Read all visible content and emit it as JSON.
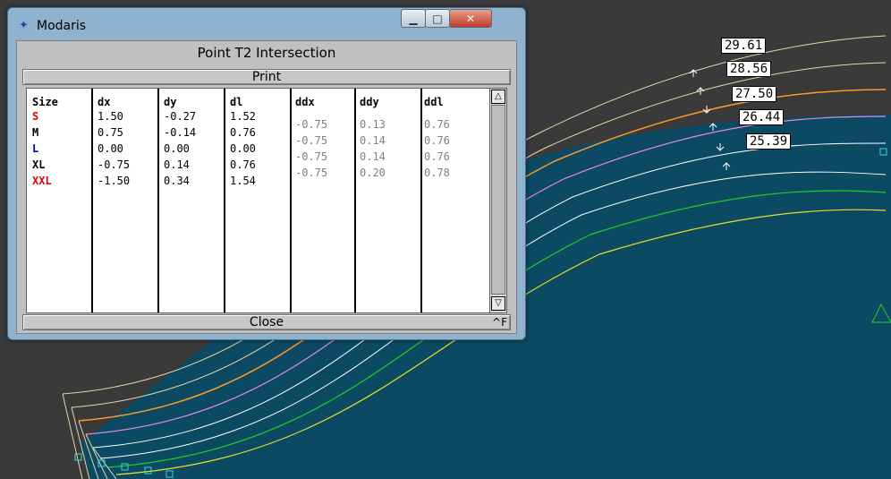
{
  "window": {
    "app_title": "Modaris",
    "controls": {
      "minimize": "▁",
      "maximize": "□",
      "close": "✕"
    }
  },
  "dialog": {
    "title": "Point T2 Intersection",
    "print_label": "Print",
    "close_label": "Close",
    "shortcut": "^F",
    "columns": [
      "Size",
      "dx",
      "dy",
      "dl",
      "ddx",
      "ddy",
      "ddl"
    ],
    "rows": [
      {
        "size": "S",
        "dx": "1.50",
        "dy": "-0.27",
        "dl": "1.52",
        "ddx": "-0.75",
        "ddy": "0.13",
        "ddl": "0.76",
        "color": "#e00000"
      },
      {
        "size": "M",
        "dx": "0.75",
        "dy": "-0.14",
        "dl": "0.76",
        "ddx": "-0.75",
        "ddy": "0.14",
        "ddl": "0.76",
        "color": "#000000"
      },
      {
        "size": "L",
        "dx": "0.00",
        "dy": "0.00",
        "dl": "0.00",
        "ddx": "-0.75",
        "ddy": "0.14",
        "ddl": "0.76",
        "color": "#0000cc"
      },
      {
        "size": "XL",
        "dx": "-0.75",
        "dy": "0.14",
        "dl": "0.76",
        "ddx": "-0.75",
        "ddy": "0.20",
        "ddl": "0.78",
        "color": "#000000"
      },
      {
        "size": "XXL",
        "dx": "-1.50",
        "dy": "0.34",
        "dl": "1.54",
        "color": "#e00000"
      }
    ]
  },
  "canvas": {
    "labels": [
      "29.61",
      "28.56",
      "27.50",
      "26.44",
      "25.39"
    ],
    "fill_color": "#0c4a63",
    "curve_colors": [
      "#e8d6a8",
      "#f0f0f0",
      "#ff9a2a",
      "#e08ad8",
      "#ffffff",
      "#ffffff",
      "#22cc22",
      "#e6e02a"
    ]
  }
}
